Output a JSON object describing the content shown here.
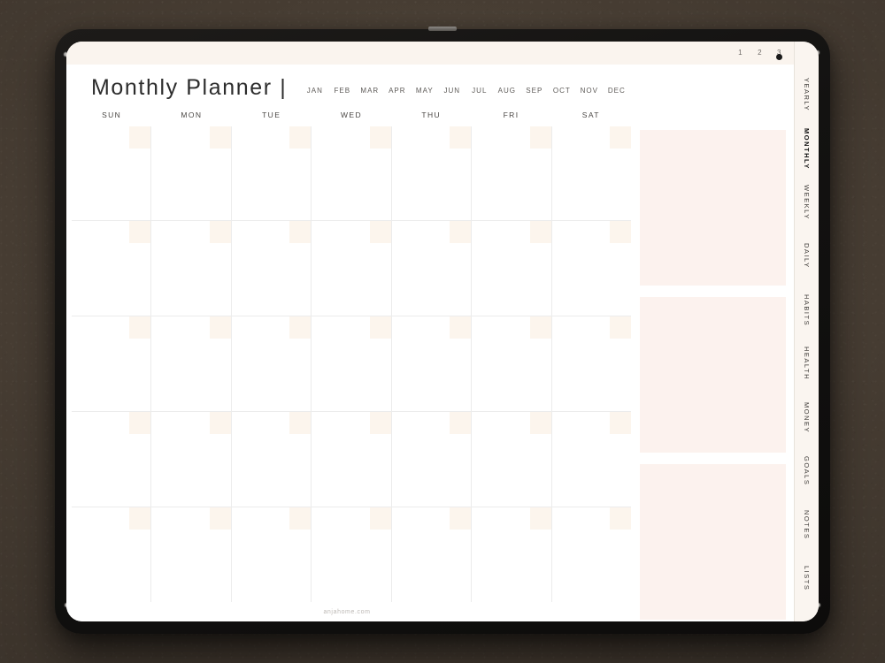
{
  "device": {
    "name": "tablet",
    "top_button": "power-button",
    "bezel_color": "#131211",
    "desk_color": "#473d33"
  },
  "header": {
    "title": "Monthly Planner |",
    "months": [
      {
        "label": "JAN"
      },
      {
        "label": "FEB"
      },
      {
        "label": "MAR"
      },
      {
        "label": "APR"
      },
      {
        "label": "MAY"
      },
      {
        "label": "JUN"
      },
      {
        "label": "JUL"
      },
      {
        "label": "AUG"
      },
      {
        "label": "SEP"
      },
      {
        "label": "OCT"
      },
      {
        "label": "NOV"
      },
      {
        "label": "DEC"
      }
    ]
  },
  "page_numbers": [
    {
      "label": "1"
    },
    {
      "label": "2"
    },
    {
      "label": "3"
    }
  ],
  "calendar": {
    "weekdays": [
      {
        "label": "SUN"
      },
      {
        "label": "MON"
      },
      {
        "label": "TUE"
      },
      {
        "label": "WED"
      },
      {
        "label": "THU"
      },
      {
        "label": "FRI"
      },
      {
        "label": "SAT"
      }
    ],
    "rows": 5,
    "columns": 7,
    "cells": [
      [
        {
          "date": ""
        },
        {
          "date": ""
        },
        {
          "date": ""
        },
        {
          "date": ""
        },
        {
          "date": ""
        },
        {
          "date": ""
        },
        {
          "date": ""
        }
      ],
      [
        {
          "date": ""
        },
        {
          "date": ""
        },
        {
          "date": ""
        },
        {
          "date": ""
        },
        {
          "date": ""
        },
        {
          "date": ""
        },
        {
          "date": ""
        }
      ],
      [
        {
          "date": ""
        },
        {
          "date": ""
        },
        {
          "date": ""
        },
        {
          "date": ""
        },
        {
          "date": ""
        },
        {
          "date": ""
        },
        {
          "date": ""
        }
      ],
      [
        {
          "date": ""
        },
        {
          "date": ""
        },
        {
          "date": ""
        },
        {
          "date": ""
        },
        {
          "date": ""
        },
        {
          "date": ""
        },
        {
          "date": ""
        }
      ],
      [
        {
          "date": ""
        },
        {
          "date": ""
        },
        {
          "date": ""
        },
        {
          "date": ""
        },
        {
          "date": ""
        },
        {
          "date": ""
        },
        {
          "date": ""
        }
      ]
    ],
    "date_box_color": "#fcf5ed",
    "grid_line_color": "#ececec"
  },
  "notes_panel": {
    "boxes": [
      {
        "content": ""
      },
      {
        "content": ""
      },
      {
        "content": ""
      }
    ],
    "box_color": "#fcf2ee"
  },
  "sidebar": {
    "tabs": [
      {
        "label": "YEARLY"
      },
      {
        "label": "MONTHLY"
      },
      {
        "label": "WEEKLY"
      },
      {
        "label": "DAILY"
      },
      {
        "label": "HABITS"
      },
      {
        "label": "HEALTH"
      },
      {
        "label": "MONEY"
      },
      {
        "label": "GOALS"
      },
      {
        "label": "NOTES"
      },
      {
        "label": "LISTS"
      }
    ]
  },
  "footer": {
    "text": "anjahome.com"
  }
}
